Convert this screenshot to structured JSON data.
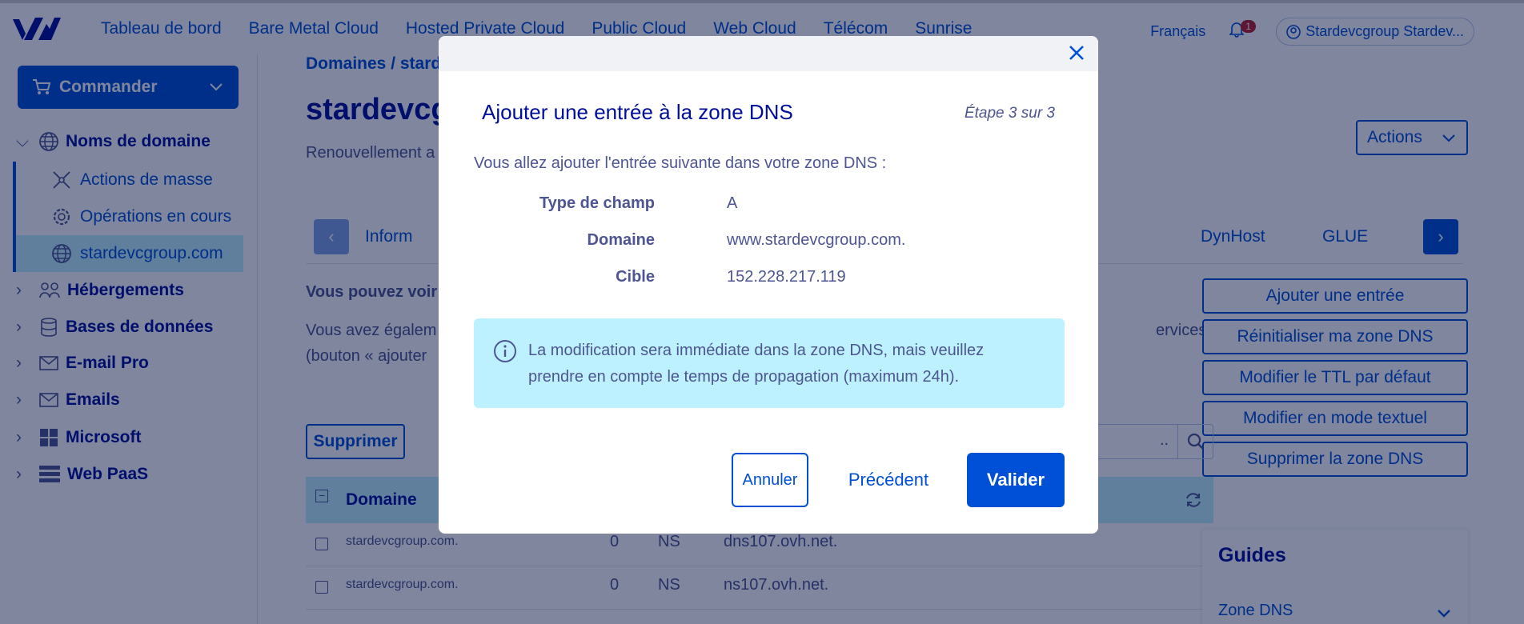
{
  "topbar": {
    "nav": [
      "Tableau de bord",
      "Bare Metal Cloud",
      "Hosted Private Cloud",
      "Public Cloud",
      "Web Cloud",
      "Télécom",
      "Sunrise"
    ],
    "language": "Français",
    "notification_count": "1",
    "user": "Stardevcgroup Stardev..."
  },
  "sidebar": {
    "order_label": "Commander",
    "domains_label": "Noms de domaine",
    "sub_items": [
      "Actions de masse",
      "Opérations en cours",
      "stardevcgroup.com"
    ],
    "items": [
      "Hébergements",
      "Bases de données",
      "E-mail Pro",
      "Emails",
      "Microsoft",
      "Web PaaS"
    ]
  },
  "main": {
    "breadcrumb": "Domaines / starde",
    "title": "stardevcg",
    "renew": "Renouvellement a",
    "actions_label": "Actions",
    "tabs": [
      "Inform",
      "DynHost",
      "GLUE"
    ],
    "text1": "Vous pouvez voir",
    "text2": "Vous avez égalem",
    "text2_end": "ervices",
    "text3": "(bouton « ajouter",
    "right_buttons": [
      "Ajouter une entrée",
      "Réinitialiser ma zone DNS",
      "Modifier le TTL par défaut",
      "Modifier en mode textuel",
      "Supprimer la zone DNS"
    ],
    "delete_label": "Supprimer",
    "search_placeholder": "..",
    "table_header": "Domaine",
    "rows": [
      {
        "domain": "stardevcgroup.com.",
        "ttl": "0",
        "type": "NS",
        "target": "dns107.ovh.net."
      },
      {
        "domain": "stardevcgroup.com.",
        "ttl": "0",
        "type": "NS",
        "target": "ns107.ovh.net."
      }
    ],
    "guides_title": "Guides",
    "guides_item": "Zone DNS"
  },
  "modal": {
    "title": "Ajouter une entrée à la zone DNS",
    "step": "Étape 3 sur 3",
    "intro": "Vous allez ajouter l'entrée suivante dans votre zone DNS :",
    "fields": [
      {
        "label": "Type de champ",
        "value": "A"
      },
      {
        "label": "Domaine",
        "value": "www.stardevcgroup.com."
      },
      {
        "label": "Cible",
        "value": "152.228.217.119"
      }
    ],
    "info": "La modification sera immédiate dans la zone DNS, mais veuillez prendre en compte le temps de propagation (maximum 24h).",
    "cancel_label": "Annuler",
    "prev_label": "Précédent",
    "ok_label": "Valider"
  },
  "colors": {
    "primary": "#0050d7",
    "title": "#000e9c",
    "text": "#4d5592",
    "info_bg": "#bef1ff",
    "badge": "#bb1f2b"
  }
}
